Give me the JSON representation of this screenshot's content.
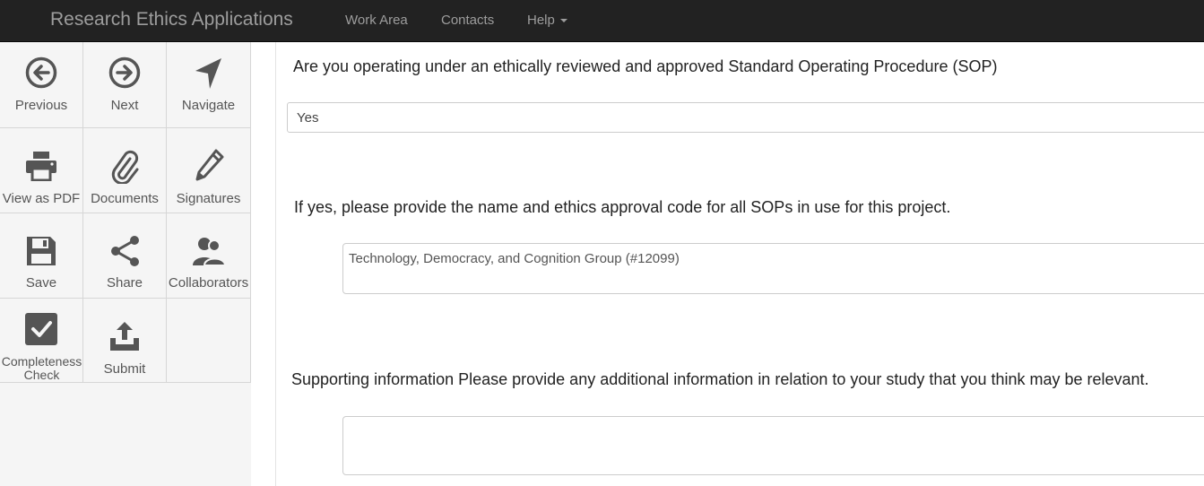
{
  "navbar": {
    "brand": "Research Ethics Applications",
    "links": [
      "Work Area",
      "Contacts",
      "Help"
    ]
  },
  "sidebar": {
    "tiles": [
      {
        "label": "Previous",
        "icon": "arrow-circle-left-icon"
      },
      {
        "label": "Next",
        "icon": "arrow-circle-right-icon"
      },
      {
        "label": "Navigate",
        "icon": "navigate-arrow-icon"
      },
      {
        "label": "View as PDF",
        "icon": "printer-icon"
      },
      {
        "label": "Documents",
        "icon": "paperclip-icon"
      },
      {
        "label": "Signatures",
        "icon": "pencil-icon"
      },
      {
        "label": "Save",
        "icon": "floppy-disk-icon"
      },
      {
        "label": "Share",
        "icon": "share-icon"
      },
      {
        "label": "Collaborators",
        "icon": "users-icon"
      },
      {
        "label": "Completeness Check",
        "icon": "checkbox-icon"
      },
      {
        "label": "Submit",
        "icon": "upload-icon"
      }
    ]
  },
  "form": {
    "q1": "Are you operating under an ethically reviewed and approved Standard Operating Procedure (SOP)",
    "q1_value": "Yes",
    "q2": "If yes, please provide the name and ethics approval code for all SOPs in use for this project.",
    "q2_value": "Technology, Democracy, and Cognition Group (#12099)",
    "q3": "Supporting information  Please provide any additional information in relation to your study that you think may be relevant.",
    "q3_value": ""
  },
  "colors": {
    "navbar_bg": "#222222",
    "nav_text": "#9d9d9d",
    "sidebar_bg": "#f5f5f5",
    "icon": "#555555"
  }
}
